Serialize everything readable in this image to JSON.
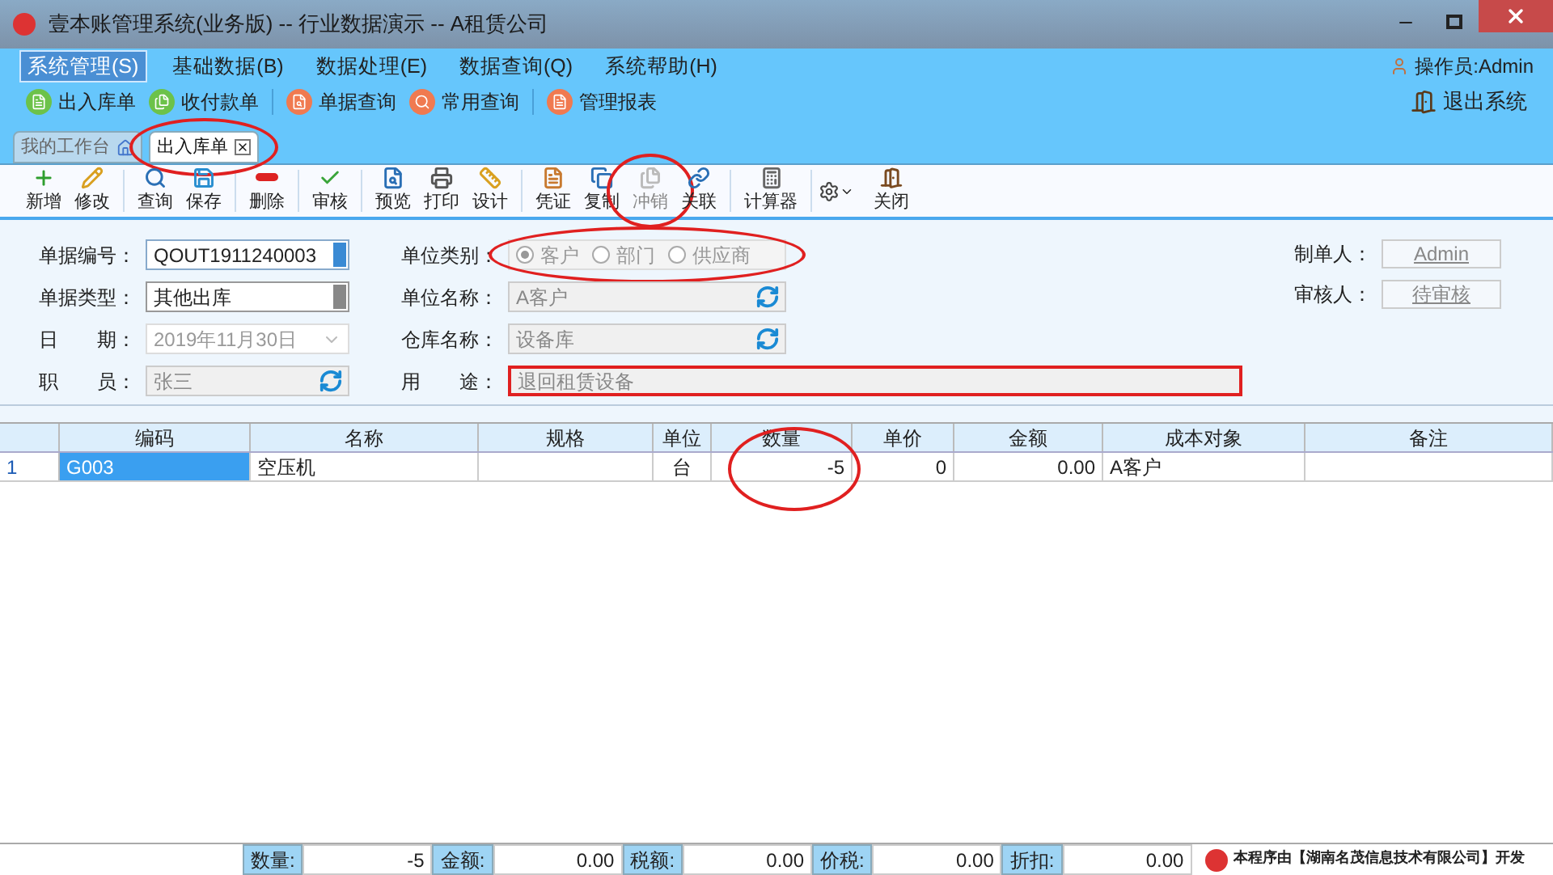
{
  "window": {
    "title": "壹本账管理系统(业务版) -- 行业数据演示 -- A租赁公司"
  },
  "menu": [
    {
      "label": "系统管理(S)",
      "selected": true
    },
    {
      "label": "基础数据(B)",
      "selected": false
    },
    {
      "label": "数据处理(E)",
      "selected": false
    },
    {
      "label": "数据查询(Q)",
      "selected": false
    },
    {
      "label": "系统帮助(H)",
      "selected": false
    }
  ],
  "operator": "操作员:Admin",
  "quick_bar": [
    {
      "label": "出入库单",
      "color": "#6cc24a"
    },
    {
      "label": "收付款单",
      "color": "#6cc24a"
    },
    {
      "label": "单据查询",
      "color": "#f07a50"
    },
    {
      "label": "常用查询",
      "color": "#f07a50"
    },
    {
      "label": "管理报表",
      "color": "#f07a50"
    }
  ],
  "exit": "退出系统",
  "tabs": [
    {
      "label": "我的工作台",
      "selected": false,
      "circled": false
    },
    {
      "label": "出入库单",
      "selected": true,
      "circled": true
    }
  ],
  "toolbar": [
    {
      "label": "新增",
      "disabled": false
    },
    {
      "label": "修改",
      "disabled": false
    },
    {
      "label": "查询",
      "disabled": false
    },
    {
      "label": "保存",
      "disabled": false
    },
    {
      "label": "删除",
      "disabled": false
    },
    {
      "label": "审核",
      "disabled": false
    },
    {
      "label": "预览",
      "disabled": false
    },
    {
      "label": "打印",
      "disabled": false
    },
    {
      "label": "设计",
      "disabled": false
    },
    {
      "label": "凭证",
      "disabled": false
    },
    {
      "label": "复制",
      "disabled": false
    },
    {
      "label": "冲销",
      "disabled": true,
      "circled": true
    },
    {
      "label": "关联",
      "disabled": false
    },
    {
      "label": "计算器",
      "disabled": false
    },
    {
      "label": "关闭",
      "disabled": false
    }
  ],
  "form": {
    "doc_no": {
      "label": "单据编号：",
      "value": "QOUT1911240003"
    },
    "doc_type": {
      "label": "单据类型：",
      "value": "其他出库"
    },
    "date": {
      "label": "日　　期：",
      "value": "2019年11月30日"
    },
    "staff": {
      "label": "职　　员：",
      "value": "张三"
    },
    "unit_type": {
      "label": "单位类别：",
      "circled": true,
      "options": [
        {
          "label": "客户",
          "selected": true
        },
        {
          "label": "部门",
          "selected": false
        },
        {
          "label": "供应商",
          "selected": false
        }
      ]
    },
    "unit_name": {
      "label": "单位名称：",
      "value": "A客户"
    },
    "warehouse": {
      "label": "仓库名称：",
      "value": "设备库"
    },
    "purpose": {
      "label": "用　　途：",
      "value": "退回租赁设备",
      "boxed": true
    },
    "maker": {
      "label": "制单人：",
      "value": "Admin"
    },
    "auditor": {
      "label": "审核人：",
      "value": "待审核"
    }
  },
  "table": {
    "columns": [
      {
        "label": "编码",
        "circled": false
      },
      {
        "label": "名称",
        "circled": false
      },
      {
        "label": "规格",
        "circled": false
      },
      {
        "label": "单位",
        "circled": false
      },
      {
        "label": "数量",
        "circled": true
      },
      {
        "label": "单价",
        "circled": false
      },
      {
        "label": "金额",
        "circled": false
      },
      {
        "label": "成本对象",
        "circled": false
      },
      {
        "label": "备注",
        "circled": false
      }
    ],
    "rows": [
      {
        "row_no": "1",
        "selected": true,
        "cells": [
          "G003",
          "空压机",
          "",
          "台",
          "-5",
          "0",
          "0.00",
          "A客户",
          ""
        ]
      }
    ]
  },
  "totals": [
    {
      "label": "数量:",
      "value": "-5"
    },
    {
      "label": "金额:",
      "value": "0.00"
    },
    {
      "label": "税额:",
      "value": "0.00"
    },
    {
      "label": "价税:",
      "value": "0.00"
    },
    {
      "label": "折扣:",
      "value": "0.00"
    }
  ],
  "credit": "本程序由【湖南名茂信息技术有限公司】开发"
}
